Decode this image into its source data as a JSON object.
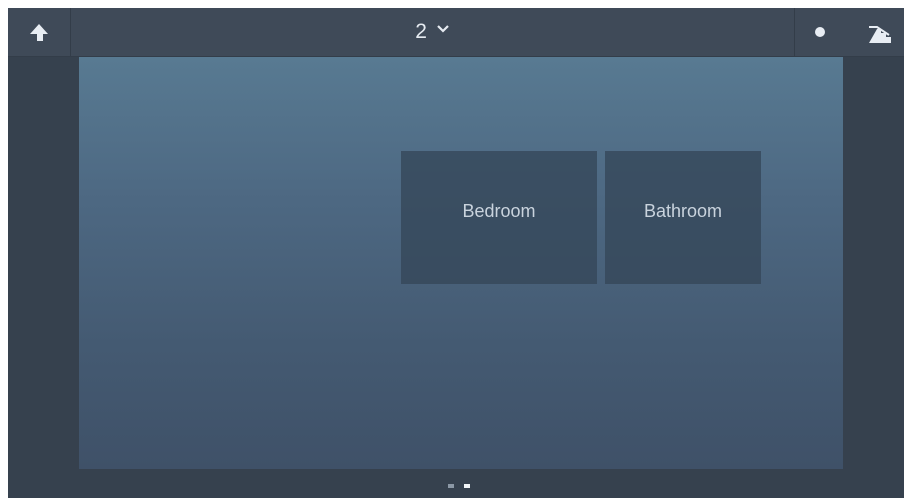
{
  "topbar": {
    "back_icon": "back-arrow-icon",
    "floor_label": "2",
    "floor_dropdown_icon": "chevron-down-icon",
    "status_icon": "dot-icon",
    "floors_icon": "stairs-icon"
  },
  "rooms": [
    {
      "label": "Bedroom"
    },
    {
      "label": "Bathroom"
    }
  ],
  "pagination": {
    "total_pages": 2,
    "active_page": 2
  },
  "colors": {
    "topbar_bg": "#3f4a58",
    "frame_bg": "#36414e",
    "tile_bg": "#344658",
    "text_light": "#e6ebf1"
  }
}
